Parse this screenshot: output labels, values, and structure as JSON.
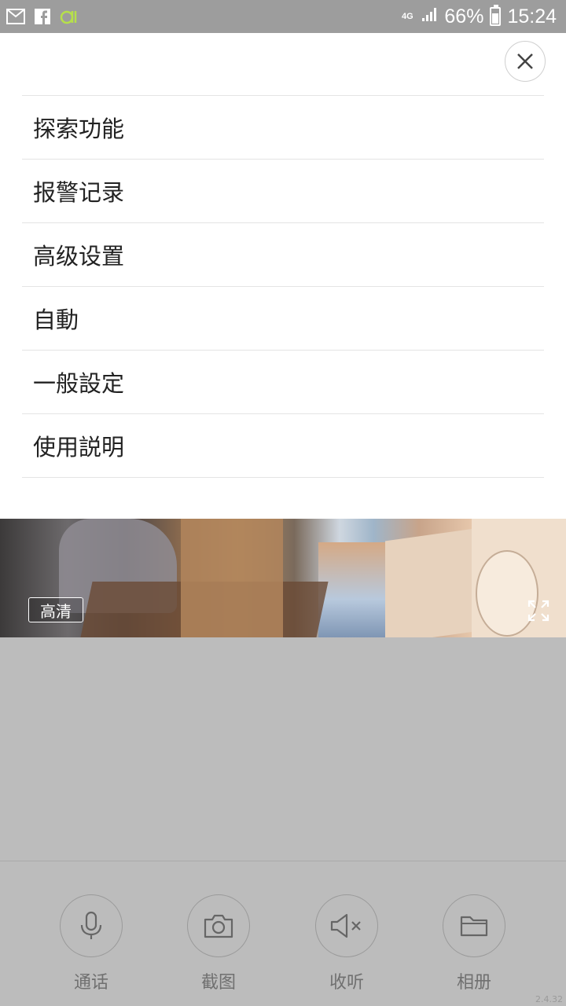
{
  "status_bar": {
    "network": "4G",
    "battery": "66%",
    "time": "15:24"
  },
  "menu": {
    "items": [
      {
        "label": "探索功能"
      },
      {
        "label": "报警记录"
      },
      {
        "label": "高级设置"
      },
      {
        "label": "自動"
      },
      {
        "label": "一般設定"
      },
      {
        "label": "使用説明"
      }
    ]
  },
  "video": {
    "quality_label": "高清"
  },
  "controls": {
    "talk_label": "通话",
    "snapshot_label": "截图",
    "listen_label": "收听",
    "album_label": "相册"
  },
  "version": "2.4.32"
}
